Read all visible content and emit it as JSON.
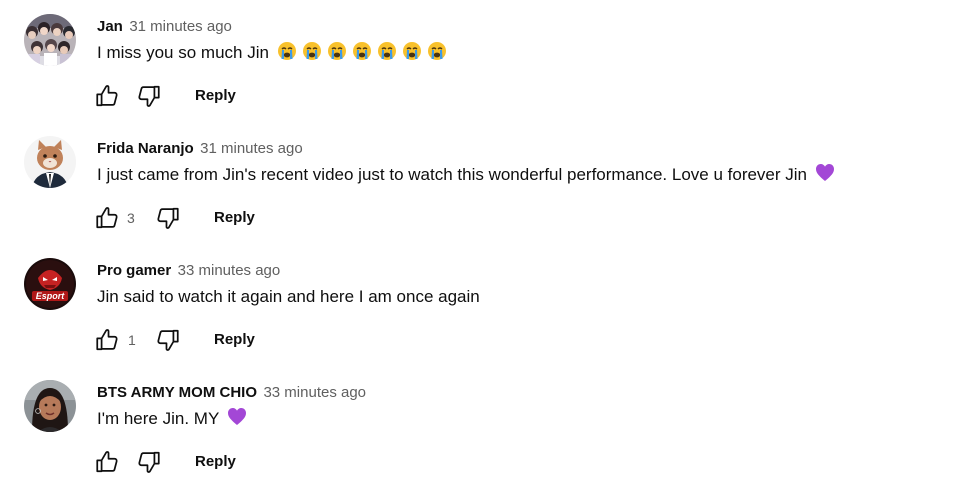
{
  "comments": [
    {
      "author": "Jan",
      "time": "31 minutes ago",
      "text": "I miss you so much Jin",
      "emojis": [
        "loudly-crying-face",
        "loudly-crying-face",
        "loudly-crying-face",
        "loudly-crying-face",
        "loudly-crying-face",
        "loudly-crying-face",
        "loudly-crying-face"
      ],
      "likes": "",
      "reply_label": "Reply"
    },
    {
      "author": "Frida Naranjo",
      "time": "31 minutes ago",
      "text": "I just came from Jin's recent video just to watch this wonderful performance. Love u forever Jin",
      "emojis": [
        "purple-heart"
      ],
      "likes": "3",
      "reply_label": "Reply"
    },
    {
      "author": "Pro gamer",
      "time": "33 minutes ago",
      "text": "Jin said to watch it again and here I am once again",
      "emojis": [],
      "likes": "1",
      "reply_label": "Reply",
      "avatar_text": "Esport"
    },
    {
      "author": "BTS ARMY MOM CHIO",
      "time": "33 minutes ago",
      "text": "I'm here Jin. MY",
      "emojis": [
        "purple-heart"
      ],
      "likes": "",
      "reply_label": "Reply"
    }
  ],
  "colors": {
    "text": "#0f0f0f",
    "secondary": "#606060",
    "purple_heart": "#a347d6",
    "crying_face": "#f8c12c",
    "tears": "#3d9be9"
  }
}
